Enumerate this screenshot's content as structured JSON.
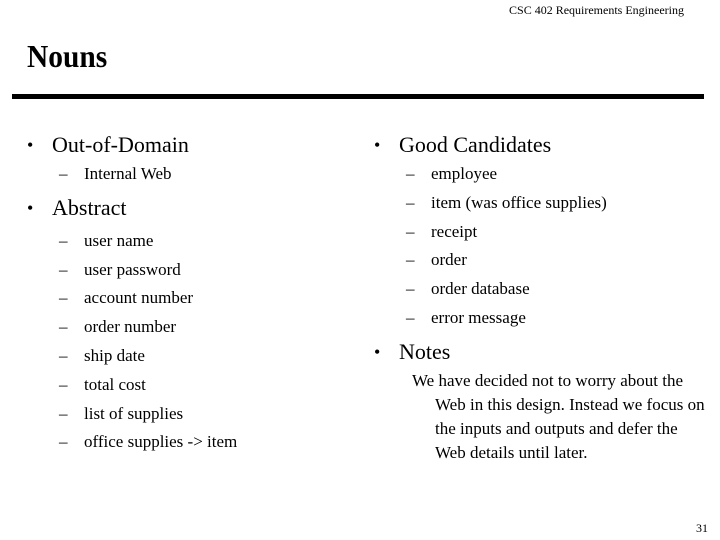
{
  "header": {
    "course": "CSC 402 Requirements Engineering"
  },
  "slide": {
    "title": "Nouns",
    "page_number": "31"
  },
  "left_column": {
    "sections": [
      {
        "label": "Out-of-Domain",
        "items": [
          "Internal Web"
        ]
      },
      {
        "label": "Abstract",
        "items": [
          "user name",
          "user password",
          "account number",
          "order number",
          "ship date",
          "total cost",
          "list of supplies",
          "office supplies -> item"
        ]
      }
    ]
  },
  "right_column": {
    "good_candidates": {
      "label": "Good Candidates",
      "items": [
        "employee",
        "item (was office supplies)",
        "receipt",
        "order",
        "order database",
        "error message"
      ]
    },
    "notes": {
      "label": "Notes",
      "text": "We have decided not to worry about the Web in this design. Instead we focus on the inputs and outputs and defer the Web details until later."
    }
  },
  "symbols": {
    "dash": "–"
  }
}
